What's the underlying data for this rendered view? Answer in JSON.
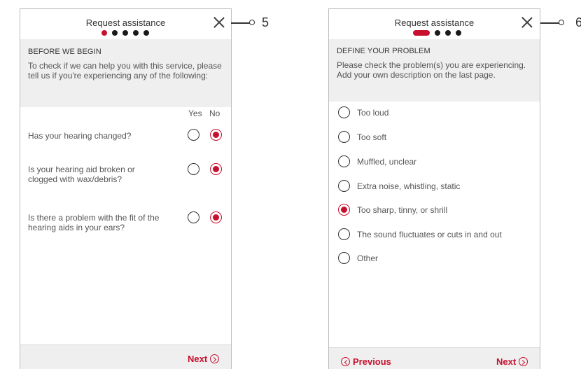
{
  "screens": [
    {
      "header": {
        "title": "Request assistance",
        "step_dots": 5,
        "active_index": 0
      },
      "intro": {
        "heading": "BEFORE WE BEGIN",
        "text": "To check if we can help you with this service, please tell us if you're experiencing any of the following:"
      },
      "columns": {
        "yes_label": "Yes",
        "no_label": "No"
      },
      "questions": [
        {
          "text": "Has your hearing changed?",
          "answer": "No"
        },
        {
          "text": "Is your hearing aid broken or clogged with wax/debris?",
          "answer": "No"
        },
        {
          "text": "Is there a problem with the fit of the hearing aids in your ears?",
          "answer": "No"
        }
      ],
      "footer": {
        "next_label": "Next"
      },
      "callout_number": "5"
    },
    {
      "header": {
        "title": "Request assistance",
        "step_dots": 4,
        "active_index": 0
      },
      "intro": {
        "heading": "DEFINE YOUR PROBLEM",
        "text": "Please check the problem(s) you are experiencing. Add your own description on the last page."
      },
      "options": [
        {
          "label": "Too loud",
          "selected": false
        },
        {
          "label": "Too soft",
          "selected": false
        },
        {
          "label": "Muffled, unclear",
          "selected": false
        },
        {
          "label": "Extra noise, whistling, static",
          "selected": false
        },
        {
          "label": "Too sharp, tinny, or shrill",
          "selected": true
        },
        {
          "label": "The sound fluctuates or cuts in and out",
          "selected": false
        },
        {
          "label": "Other",
          "selected": false
        }
      ],
      "footer": {
        "previous_label": "Previous",
        "next_label": "Next"
      },
      "callout_number": "6"
    }
  ],
  "colors": {
    "accent": "#c8102e",
    "panel_bg": "#efefef",
    "text": "#555555"
  }
}
